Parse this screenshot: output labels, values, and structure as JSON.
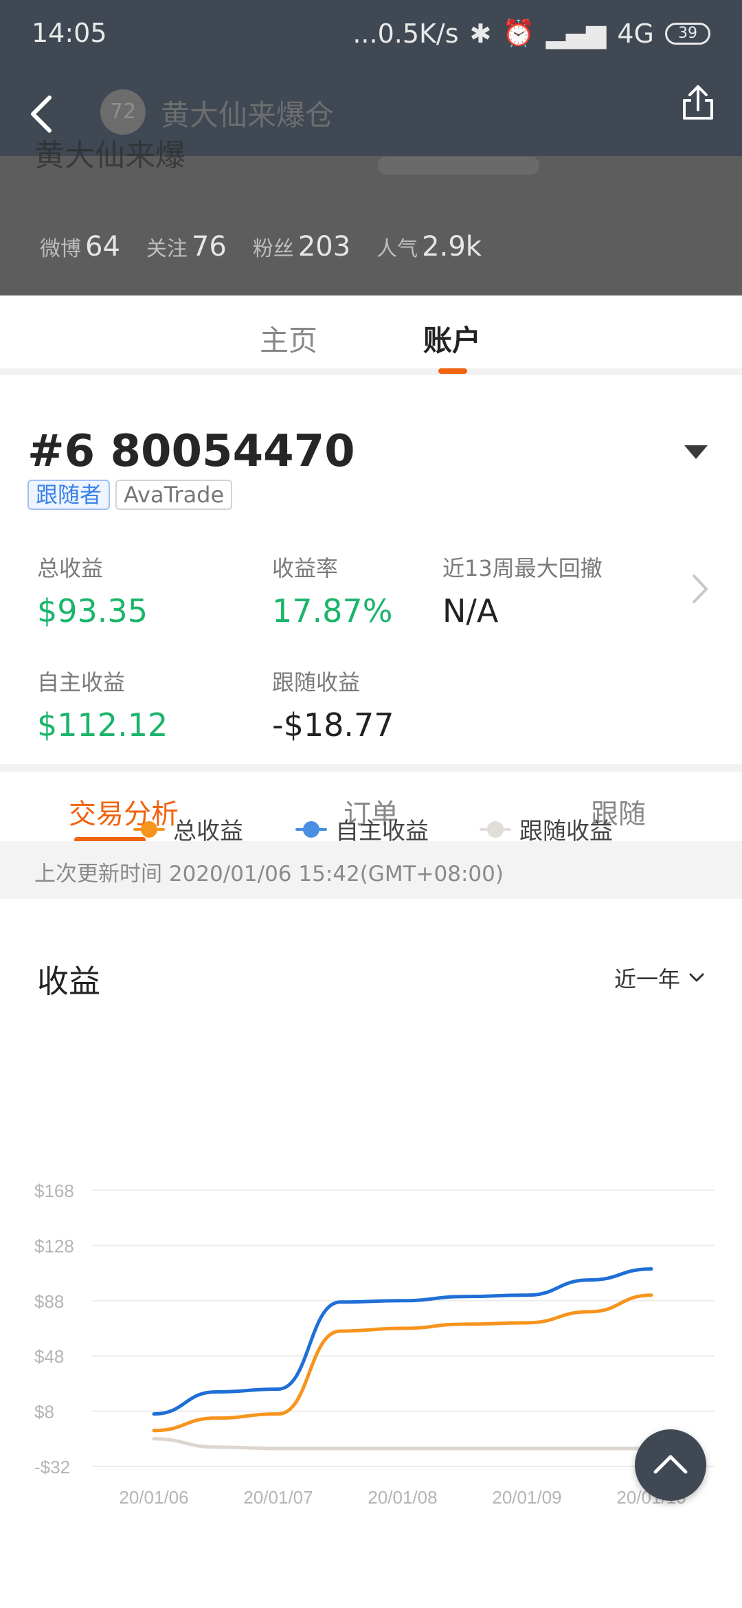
{
  "status_bar": {
    "time": "14:05",
    "network": "...0.5K/s",
    "signal": "4G",
    "battery": "39"
  },
  "header": {
    "avatar_text": "72",
    "title": "黄大仙来爆仓",
    "name_ghost": "黄大仙来爆",
    "stats": [
      {
        "label": "微博",
        "value": "64"
      },
      {
        "label": "关注",
        "value": "76"
      },
      {
        "label": "粉丝",
        "value": "203"
      },
      {
        "label": "人气",
        "value": "2.9k"
      }
    ]
  },
  "profile_tabs": {
    "home": "主页",
    "account": "账户"
  },
  "account": {
    "title": "#6 80054470",
    "tag_role": "跟随者",
    "tag_broker": "AvaTrade",
    "metrics": {
      "total_profit": {
        "label": "总收益",
        "value": "$93.35"
      },
      "return_rate": {
        "label": "收益率",
        "value": "17.87%"
      },
      "max_drawdown": {
        "label": "近13周最大回撤",
        "value": "N/A"
      },
      "own_profit": {
        "label": "自主收益",
        "value": "$112.12"
      },
      "follow_profit": {
        "label": "跟随收益",
        "value": "-$18.77"
      }
    }
  },
  "section_tabs": {
    "analysis": "交易分析",
    "orders": "订单",
    "follow": "跟随"
  },
  "update_time": "上次更新时间 2020/01/06 15:42(GMT+08:00)",
  "chart": {
    "title": "收益",
    "range_label": "近一年"
  },
  "colors": {
    "accent": "#f0640f",
    "green": "#19b56a",
    "total": "#f7941d",
    "own": "#1f6fd6",
    "follow": "#ddd6cf"
  },
  "chart_data": {
    "type": "line",
    "x": [
      "20/01/06",
      "",
      "20/01/07",
      "",
      "20/01/08",
      "",
      "20/01/09",
      "",
      "20/01/10"
    ],
    "yticks": [
      "$168",
      "$128",
      "$88",
      "$48",
      "$8",
      "-$32"
    ],
    "ylim": [
      -32,
      168
    ],
    "series": [
      {
        "name": "总收益",
        "values": [
          -6,
          3,
          6,
          66,
          68,
          71,
          72,
          80,
          92
        ]
      },
      {
        "name": "自主收益",
        "values": [
          6,
          22,
          24,
          87,
          88,
          91,
          92,
          103,
          111
        ]
      },
      {
        "name": "跟随收益",
        "values": [
          -12,
          -18,
          -19,
          -19,
          -19,
          -19,
          -19,
          -19,
          -19
        ]
      }
    ],
    "legend_position": "bottom",
    "grid": true
  }
}
